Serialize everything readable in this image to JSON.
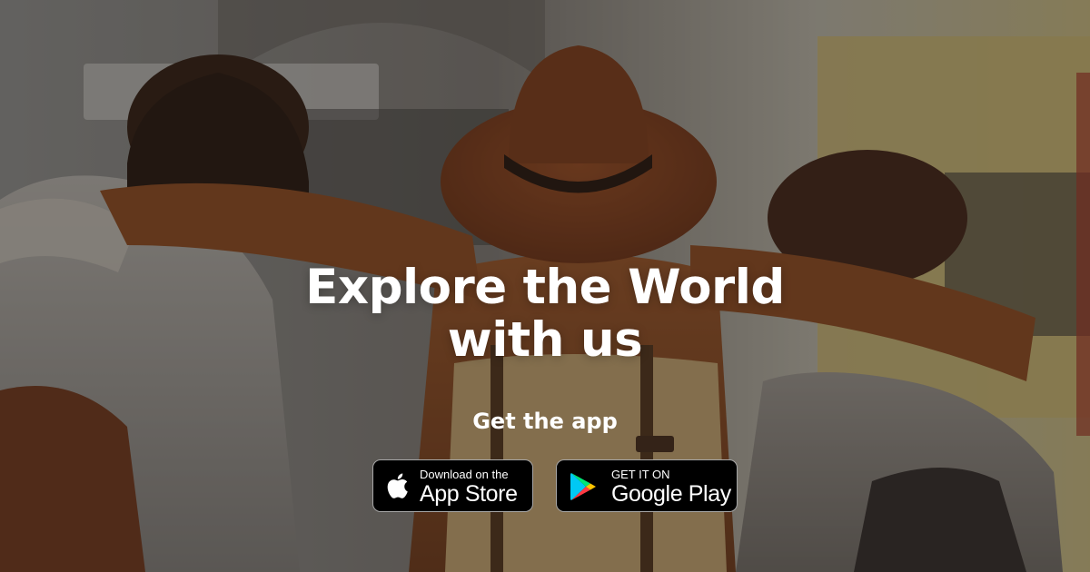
{
  "hero": {
    "headline_line1": "Explore the World",
    "headline_line2": "with us",
    "cta_label": "Get the app",
    "background_image": "three-friends-arm-in-arm-back-view"
  },
  "app_store": {
    "small_text": "Download on the",
    "big_text": "App Store",
    "icon": "apple-logo-icon"
  },
  "google_play": {
    "small_text": "GET IT ON",
    "big_text": "Google Play",
    "icon": "google-play-icon"
  },
  "colors": {
    "text": "#ffffff",
    "badge_background": "#000000",
    "badge_border": "#a6a6a6",
    "hat": "#8a4523",
    "jacket": "#8e5027"
  }
}
